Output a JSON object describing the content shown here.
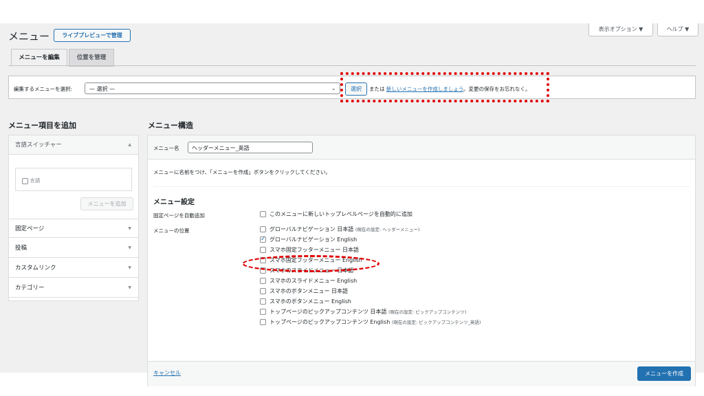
{
  "screen_options": {
    "display_options": "表示オプション ▼",
    "help": "ヘルプ ▼"
  },
  "page": {
    "title": "メニュー",
    "live_preview": "ライブプレビューで管理"
  },
  "tabs": [
    {
      "label": "メニューを編集"
    },
    {
      "label": "位置を管理"
    }
  ],
  "select_bar": {
    "label": "編集するメニューを選択:",
    "selected": "— 選択 —",
    "select_button": "選択",
    "or_text": "または",
    "create_link": "新しいメニューを作成しましょう",
    "save_note": "。変更の保存をお忘れなく。"
  },
  "sidebar": {
    "heading": "メニュー項目を追加",
    "sections": [
      {
        "label": "言語スイッチャー",
        "arrow": "▲"
      },
      {
        "label": "固定ページ",
        "arrow": "▼"
      },
      {
        "label": "投稿",
        "arrow": "▼"
      },
      {
        "label": "カスタムリンク",
        "arrow": "▼"
      },
      {
        "label": "カテゴリー",
        "arrow": "▼"
      }
    ],
    "language_item": "言語",
    "add_button": "メニューを追加"
  },
  "main": {
    "heading": "メニュー構造",
    "name_label": "メニュー名",
    "name_value": "ヘッダーメニュー_英語",
    "instruction": "メニューに名前をつけ、「メニューを作成」ボタンをクリックしてください。",
    "settings_heading": "メニュー設定",
    "auto_add_label": "固定ページを自動追加",
    "auto_add_option": "このメニューに新しいトップレベルページを自動的に追加",
    "location_label": "メニューの位置",
    "locations": [
      {
        "label": "グローバルナビゲーション 日本語",
        "note": "(現在の設定: ヘッダーメニュー)",
        "checked": false
      },
      {
        "label": "グローバルナビゲーション English",
        "note": "",
        "checked": true
      },
      {
        "label": "スマホ固定フッターメニュー 日本語",
        "note": "",
        "checked": false
      },
      {
        "label": "スマホ固定フッターメニュー English",
        "note": "",
        "checked": false
      },
      {
        "label": "スマホのスライドメニュー 日本語",
        "note": "",
        "checked": false
      },
      {
        "label": "スマホのスライドメニュー English",
        "note": "",
        "checked": false
      },
      {
        "label": "スマホのボタンメニュー 日本語",
        "note": "",
        "checked": false
      },
      {
        "label": "スマホのボタンメニュー English",
        "note": "",
        "checked": false
      },
      {
        "label": "トップページのピックアップコンテンツ 日本語",
        "note": "(現在の設定: ピックアップコンテンツ)",
        "checked": false
      },
      {
        "label": "トップページのピックアップコンテンツ English",
        "note": "(現在の設定: ピックアップコンテンツ_英語)",
        "checked": false
      }
    ],
    "cancel": "キャンセル",
    "create_button": "メニューを作成"
  },
  "colors": {
    "accent": "#2271b1",
    "highlight": "#e00000",
    "background": "#f0f0f1"
  }
}
